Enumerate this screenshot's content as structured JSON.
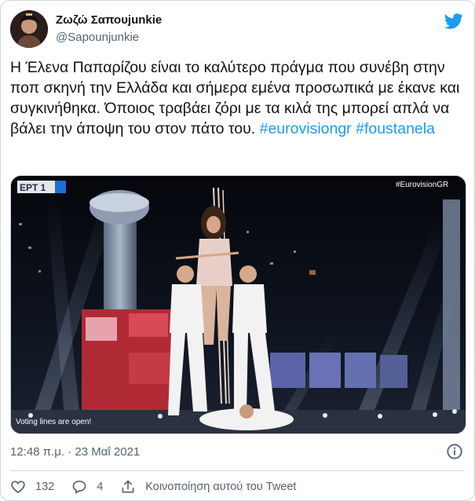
{
  "tweet": {
    "display_name": "Ζωζώ Σαπουjunkie",
    "handle": "@Sapounjunkie",
    "text_plain": "Η Έλενα Παπαρίζου είναι το καλύτερο πράγμα που συνέβη στην ποπ σκηνή την Ελλάδα και σήμερα εμένα προσωπικά με έκανε και συγκινήθηκα. Όποιος τραβάει ζόρι με τα κιλά της μπορεί απλά να βάλει την άποψη του στον πάτο του.",
    "hashtags": [
      "#eurovisiongr",
      "#foustanela"
    ],
    "timestamp": "12:48 π.μ. · 23 Μαΐ 2021"
  },
  "media": {
    "channel_logo": "ΕΡΤ 1",
    "broadcast_tag": "#EurovisionGR",
    "ticker": "Voting lines are open!"
  },
  "actions": {
    "like_count": "132",
    "reply_count": "4",
    "share_label": "Κοινοποίηση αυτού του Tweet"
  },
  "icons": {
    "brand": "twitter-bird-icon",
    "info": "info-icon",
    "like": "heart-icon",
    "reply": "speech-bubble-icon",
    "share": "share-icon"
  },
  "colors": {
    "link": "#1d9bf0",
    "secondary_text": "#536471",
    "brand": "#1d9bf0"
  }
}
